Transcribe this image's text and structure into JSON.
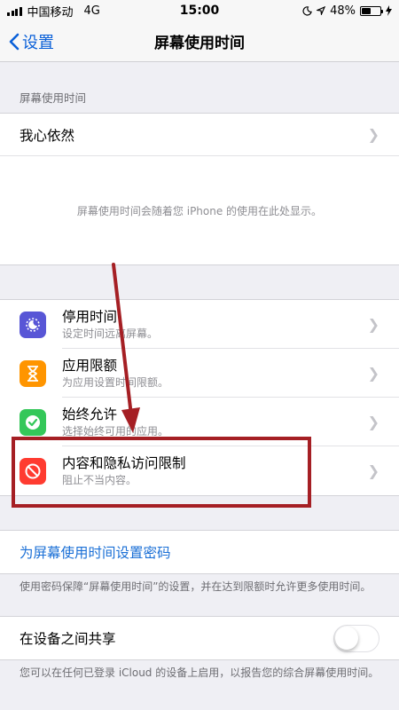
{
  "status_bar": {
    "carrier": "中国移动",
    "network": "4G",
    "time": "15:00",
    "battery": "48%",
    "battery_level": 0.48
  },
  "nav": {
    "back_label": "设置",
    "title": "屏幕使用时间"
  },
  "screen_time_section": {
    "header": "屏幕使用时间",
    "device_name": "我心依然",
    "info_text": "屏幕使用时间会随着您 iPhone 的使用在此处显示。"
  },
  "features": [
    {
      "title": "停用时间",
      "subtitle": "设定时间远离屏幕。",
      "icon": "moon-icon",
      "color": "#5856d6"
    },
    {
      "title": "应用限额",
      "subtitle": "为应用设置时间限额。",
      "icon": "hourglass-icon",
      "color": "#ff9500"
    },
    {
      "title": "始终允许",
      "subtitle": "选择始终可用的应用。",
      "icon": "checkmark-seal-icon",
      "color": "#34c759"
    },
    {
      "title": "内容和隐私访问限制",
      "subtitle": "阻止不当内容。",
      "icon": "prohibited-icon",
      "color": "#ff3b30"
    }
  ],
  "passcode": {
    "link_label": "为屏幕使用时间设置密码",
    "footnote": "使用密码保障“屏幕使用时间”的设置，并在达到限额时允许更多使用时间。"
  },
  "share": {
    "label": "在设备之间共享",
    "enabled": false,
    "footnote": "您可以在任何已登录 iCloud 的设备上启用，以报告您的综合屏幕使用时间。"
  },
  "colors": {
    "accent": "#0a60d8",
    "annotation": "#a51f24"
  }
}
